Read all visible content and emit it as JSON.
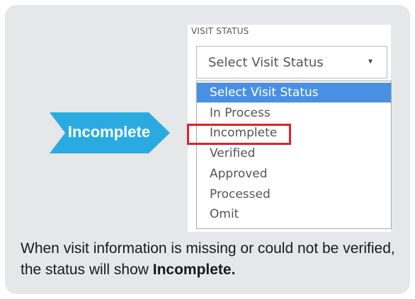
{
  "field": {
    "label": "VISIT STATUS",
    "selected_value": "Select Visit Status",
    "caret_icon": "chevron-down-icon"
  },
  "dropdown": {
    "options": [
      "Select Visit Status",
      "In Process",
      "Incomplete",
      "Verified",
      "Approved",
      "Processed",
      "Omit"
    ],
    "highlighted_option": "Select Visit Status",
    "boxed_option": "Incomplete"
  },
  "callout": {
    "label": "Incomplete"
  },
  "caption": {
    "line1": "When visit information is missing or could not be verified, the status will show ",
    "emphasis": "Incomplete."
  },
  "colors": {
    "card_bg": "#e6e7e8",
    "selected_option": "#4a90e2",
    "highlight_box": "#e0212b",
    "callout_arrow": "#29abe2"
  }
}
